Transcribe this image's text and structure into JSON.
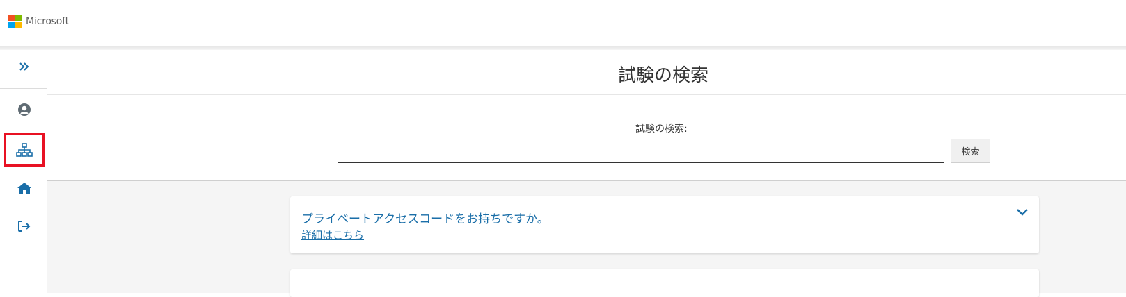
{
  "header": {
    "brand_name": "Microsoft",
    "logo_colors": [
      "#f25022",
      "#7fba00",
      "#00a4ef",
      "#ffb900"
    ]
  },
  "sidebar": {
    "items": [
      {
        "icon": "double-chevron-right-icon",
        "selected": false
      },
      {
        "icon": "user-circle-icon",
        "selected": false
      },
      {
        "icon": "sitemap-icon",
        "selected": true
      },
      {
        "icon": "home-icon",
        "selected": false
      },
      {
        "icon": "sign-out-icon",
        "selected": false
      }
    ],
    "icon_color": "#1a6ea8",
    "selection_color": "#e81123"
  },
  "main": {
    "page_title": "試験の検索",
    "search": {
      "label": "試験の検索:",
      "value": "",
      "button_label": "検索"
    },
    "cards": [
      {
        "title": "プライベートアクセスコードをお持ちですか。",
        "link_text": "詳細はこちら",
        "expand_icon": "chevron-down-icon"
      }
    ]
  }
}
